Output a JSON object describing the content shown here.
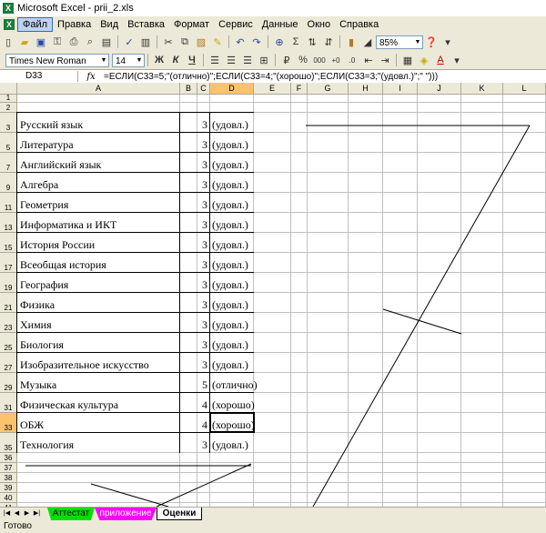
{
  "window": {
    "title": "Microsoft Excel - prii_2.xls"
  },
  "menu": [
    "Файл",
    "Правка",
    "Вид",
    "Вставка",
    "Формат",
    "Сервис",
    "Данные",
    "Окно",
    "Справка"
  ],
  "toolbar": {
    "zoom": "85%",
    "font": "Times New Roman",
    "size": "14",
    "bold": "Ж",
    "italic": "К",
    "underline": "Ч",
    "percent": "%",
    "thousands": "000",
    "sigma": "Σ"
  },
  "formula_bar": {
    "cell_ref": "D33",
    "fx": "fx",
    "formula": "=ЕСЛИ(C33=5;\"(отлично)\";ЕСЛИ(C33=4;\"(хорошо)\";ЕСЛИ(C33=3;\"(удовл.)\";\" \")))"
  },
  "columns": [
    "A",
    "B",
    "C",
    "D",
    "E",
    "F",
    "G",
    "H",
    "I",
    "J",
    "K",
    "L"
  ],
  "rows": [
    {
      "num": "1",
      "subject": "",
      "grade": "",
      "result": ""
    },
    {
      "num": "2",
      "subject": "",
      "grade": "",
      "result": ""
    },
    {
      "num": "3",
      "subject": "Русский язык",
      "grade": "3",
      "result": "(удовл.)"
    },
    {
      "num": "5",
      "subject": "Литература",
      "grade": "3",
      "result": "(удовл.)"
    },
    {
      "num": "7",
      "subject": "Английский язык",
      "grade": "3",
      "result": "(удовл.)"
    },
    {
      "num": "9",
      "subject": "Алгебра",
      "grade": "3",
      "result": "(удовл.)"
    },
    {
      "num": "11",
      "subject": "Геометрия",
      "grade": "3",
      "result": "(удовл.)"
    },
    {
      "num": "13",
      "subject": "Информатика и ИКТ",
      "grade": "3",
      "result": "(удовл.)"
    },
    {
      "num": "15",
      "subject": "История России",
      "grade": "3",
      "result": "(удовл.)"
    },
    {
      "num": "17",
      "subject": "Всеобщая история",
      "grade": "3",
      "result": "(удовл.)"
    },
    {
      "num": "19",
      "subject": "География",
      "grade": "3",
      "result": "(удовл.)"
    },
    {
      "num": "21",
      "subject": "Физика",
      "grade": "3",
      "result": "(удовл.)"
    },
    {
      "num": "23",
      "subject": "Химия",
      "grade": "3",
      "result": "(удовл.)"
    },
    {
      "num": "25",
      "subject": "Биология",
      "grade": "3",
      "result": "(удовл.)"
    },
    {
      "num": "27",
      "subject": "Изобразительное искусство",
      "grade": "3",
      "result": "(удовл.)"
    },
    {
      "num": "29",
      "subject": "Музыка",
      "grade": "5",
      "result": "(отлично)"
    },
    {
      "num": "31",
      "subject": "Физическая культура",
      "grade": "4",
      "result": "(хорошо)"
    },
    {
      "num": "33",
      "subject": "ОБЖ",
      "grade": "4",
      "result": "(хорошо)"
    },
    {
      "num": "35",
      "subject": "Технология",
      "grade": "3",
      "result": "(удовл.)"
    },
    {
      "num": "36",
      "subject": "",
      "grade": "",
      "result": ""
    },
    {
      "num": "37",
      "subject": "",
      "grade": "",
      "result": ""
    },
    {
      "num": "38",
      "subject": "",
      "grade": "",
      "result": ""
    },
    {
      "num": "39",
      "subject": "",
      "grade": "",
      "result": ""
    },
    {
      "num": "40",
      "subject": "",
      "grade": "",
      "result": ""
    },
    {
      "num": "41",
      "subject": "",
      "grade": "",
      "result": ""
    }
  ],
  "sheet_tabs": [
    {
      "label": "Аттестат",
      "color": "#00e000"
    },
    {
      "label": "приложение",
      "color": "#ff00ff"
    },
    {
      "label": "Оценки",
      "color": "#ffffff"
    }
  ],
  "status": "Готово"
}
